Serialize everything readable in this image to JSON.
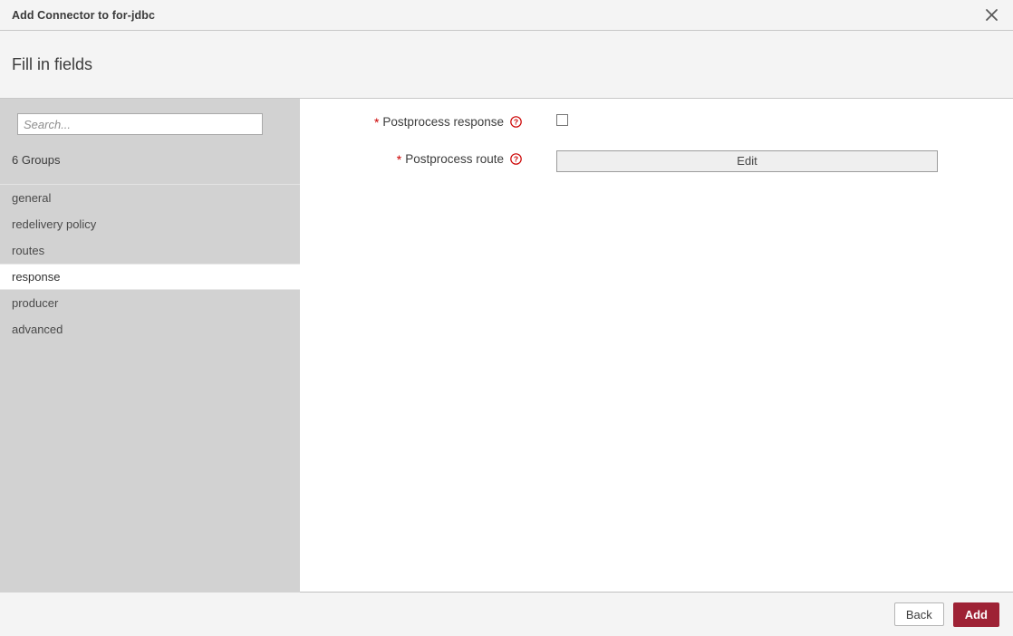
{
  "titlebar": {
    "title": "Add Connector to for-jdbc",
    "close_icon": "close-icon"
  },
  "subheader": {
    "title": "Fill in fields"
  },
  "sidebar": {
    "search": {
      "value": "",
      "placeholder": "Search..."
    },
    "groups_count_label": "6 Groups",
    "items": [
      {
        "label": "general",
        "selected": false
      },
      {
        "label": "redelivery policy",
        "selected": false
      },
      {
        "label": "routes",
        "selected": false
      },
      {
        "label": "response",
        "selected": true
      },
      {
        "label": "producer",
        "selected": false
      },
      {
        "label": "advanced",
        "selected": false
      }
    ]
  },
  "form": {
    "fields": [
      {
        "required_marker": "*",
        "label": "Postprocess response",
        "help_icon": "help-circle-icon",
        "control": "checkbox",
        "checked": false
      },
      {
        "required_marker": "*",
        "label": "Postprocess route",
        "help_icon": "help-circle-icon",
        "control": "button",
        "button_label": "Edit"
      }
    ]
  },
  "footer": {
    "back_label": "Back",
    "add_label": "Add"
  },
  "colors": {
    "accent": "#9e2235",
    "required": "#cc0000",
    "sidebar_bg": "#d2d2d2",
    "header_bg": "#f4f4f4"
  }
}
